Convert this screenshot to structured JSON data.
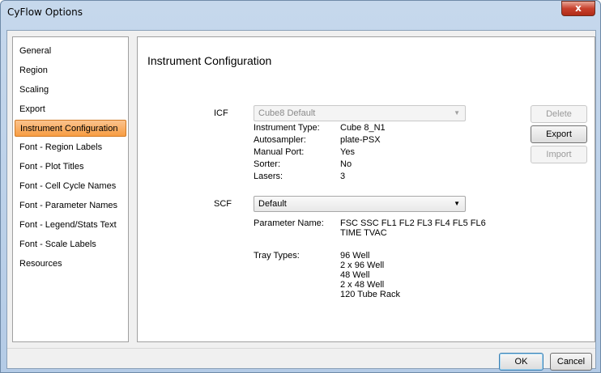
{
  "window": {
    "title": "CyFlow Options",
    "close_glyph": "x"
  },
  "sidebar": {
    "items": [
      {
        "label": "General"
      },
      {
        "label": "Region"
      },
      {
        "label": "Scaling"
      },
      {
        "label": "Export"
      },
      {
        "label": "Instrument Configuration",
        "selected": true
      },
      {
        "label": "Font - Region Labels"
      },
      {
        "label": "Font - Plot Titles"
      },
      {
        "label": "Font - Cell Cycle Names"
      },
      {
        "label": "Font - Parameter Names"
      },
      {
        "label": "Font - Legend/Stats Text"
      },
      {
        "label": "Font - Scale Labels"
      },
      {
        "label": "Resources"
      }
    ]
  },
  "panel": {
    "title": "Instrument Configuration",
    "icf": {
      "label": "ICF",
      "value": "Cube8 Default",
      "enabled": false,
      "details": [
        {
          "key": "Instrument Type:",
          "value": "Cube 8_N1"
        },
        {
          "key": "Autosampler:",
          "value": "plate-PSX"
        },
        {
          "key": "Manual Port:",
          "value": "Yes"
        },
        {
          "key": "Sorter:",
          "value": "No"
        },
        {
          "key": "Lasers:",
          "value": "3"
        }
      ]
    },
    "scf": {
      "label": "SCF",
      "value": "Default",
      "enabled": true,
      "parameter_name_label": "Parameter Name:",
      "parameter_name_line1": "FSC SSC FL1 FL2 FL3 FL4 FL5 FL6",
      "parameter_name_line2": "TIME TVAC",
      "tray_types_label": "Tray Types:",
      "tray_types": [
        "96 Well",
        "2 x 96 Well",
        "48 Well",
        "2 x 48 Well",
        "120 Tube Rack"
      ]
    },
    "buttons": {
      "delete": {
        "label": "Delete",
        "enabled": false
      },
      "export": {
        "label": "Export",
        "enabled": true
      },
      "import": {
        "label": "Import",
        "enabled": false
      }
    }
  },
  "footer": {
    "ok": "OK",
    "cancel": "Cancel"
  },
  "colors": {
    "selection": "#f79d43",
    "title_bar": "#b4cbe6",
    "close_button": "#c8412d"
  }
}
